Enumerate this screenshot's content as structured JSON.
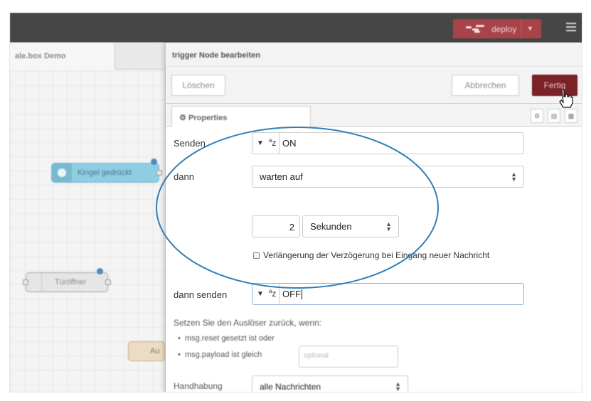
{
  "topbar": {
    "deploy_label": "deploy"
  },
  "flow": {
    "tab_label": "ale.box Demo",
    "nodes": {
      "kingel": "Kingel gedrückt",
      "tuer": "Türöffner",
      "au": "Au"
    }
  },
  "tray": {
    "title": "trigger Node bearbeiten",
    "buttons": {
      "delete": "Löschen",
      "cancel": "Abbrechen",
      "done": "Fertig"
    },
    "tab_properties": "Properties"
  },
  "form": {
    "send": {
      "label": "Senden",
      "value": "ON"
    },
    "then": {
      "label": "dann",
      "value": "warten auf"
    },
    "wait": {
      "amount": "2",
      "unit": "Sekunden"
    },
    "extend": {
      "label": "Verlängerung der Verzögerung bei Eingang neuer Nachricht",
      "checked": false
    },
    "then_send": {
      "label": "dann senden",
      "value": "OFF"
    },
    "reset": {
      "intro": "Setzen Sie den Auslöser zurück, wenn:",
      "item1": "msg.reset gesetzt ist oder",
      "item2": "msg.payload ist gleich",
      "placeholder": "optional"
    },
    "handling": {
      "label": "Handhabung",
      "value": "alle Nachrichten"
    }
  },
  "colors": {
    "deploy": "#a8434a",
    "done": "#7a2228",
    "annotation": "#2f7fb8"
  }
}
